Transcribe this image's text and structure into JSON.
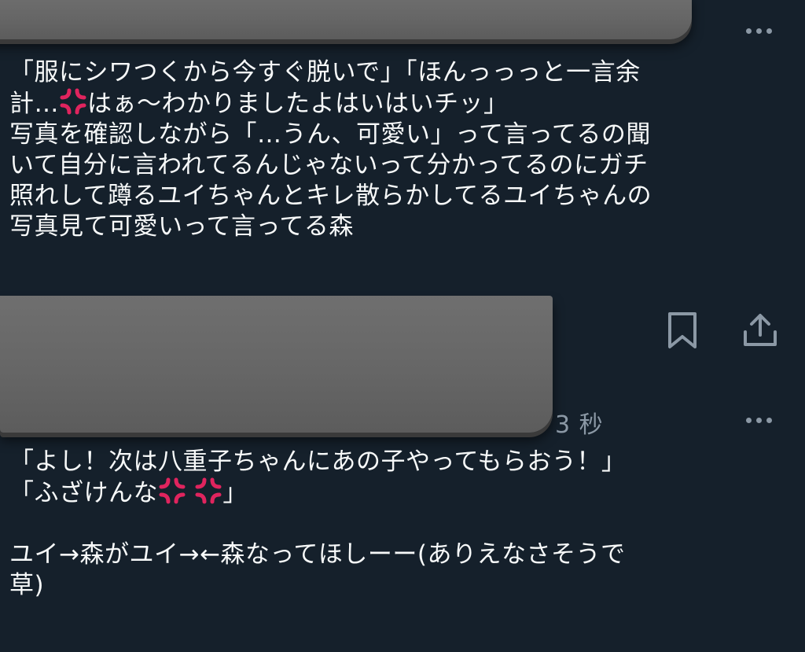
{
  "post_top": {
    "more_icon": "more-horizontal-icon",
    "line1": "「服にシワつくから今すぐ脱いで」「ほんっっっと一言余",
    "line2a": "計…",
    "line2b": "はぁ〜わかりましたよはいはいチッ」",
    "rest": "写真を確認しながら「…うん、可愛い」って言ってるの聞\nいて自分に言われてるんじゃないって分かってるのにガチ\n照れして蹲るユイちゃんとキレ散らかしてるユイちゃんの\n写真見て可愛いって言ってる森"
  },
  "actions": {
    "bookmark_icon": "bookmark-icon",
    "share_icon": "share-icon"
  },
  "post_bottom": {
    "timestamp": "3 秒",
    "more_icon": "more-horizontal-icon",
    "line1": "「よし！次は八重子ちゃんにあの子やってもらおう！」",
    "line2a": "「ふざけんな",
    "line2b": "」",
    "rest": "\nユイ→森がユイ→←森なってほしーー(ありえなさそうで\n草)"
  },
  "colors": {
    "background": "#15202b",
    "text": "#f7f9f9",
    "muted": "#8b98a5",
    "anger_emoji": "#e0245e"
  }
}
